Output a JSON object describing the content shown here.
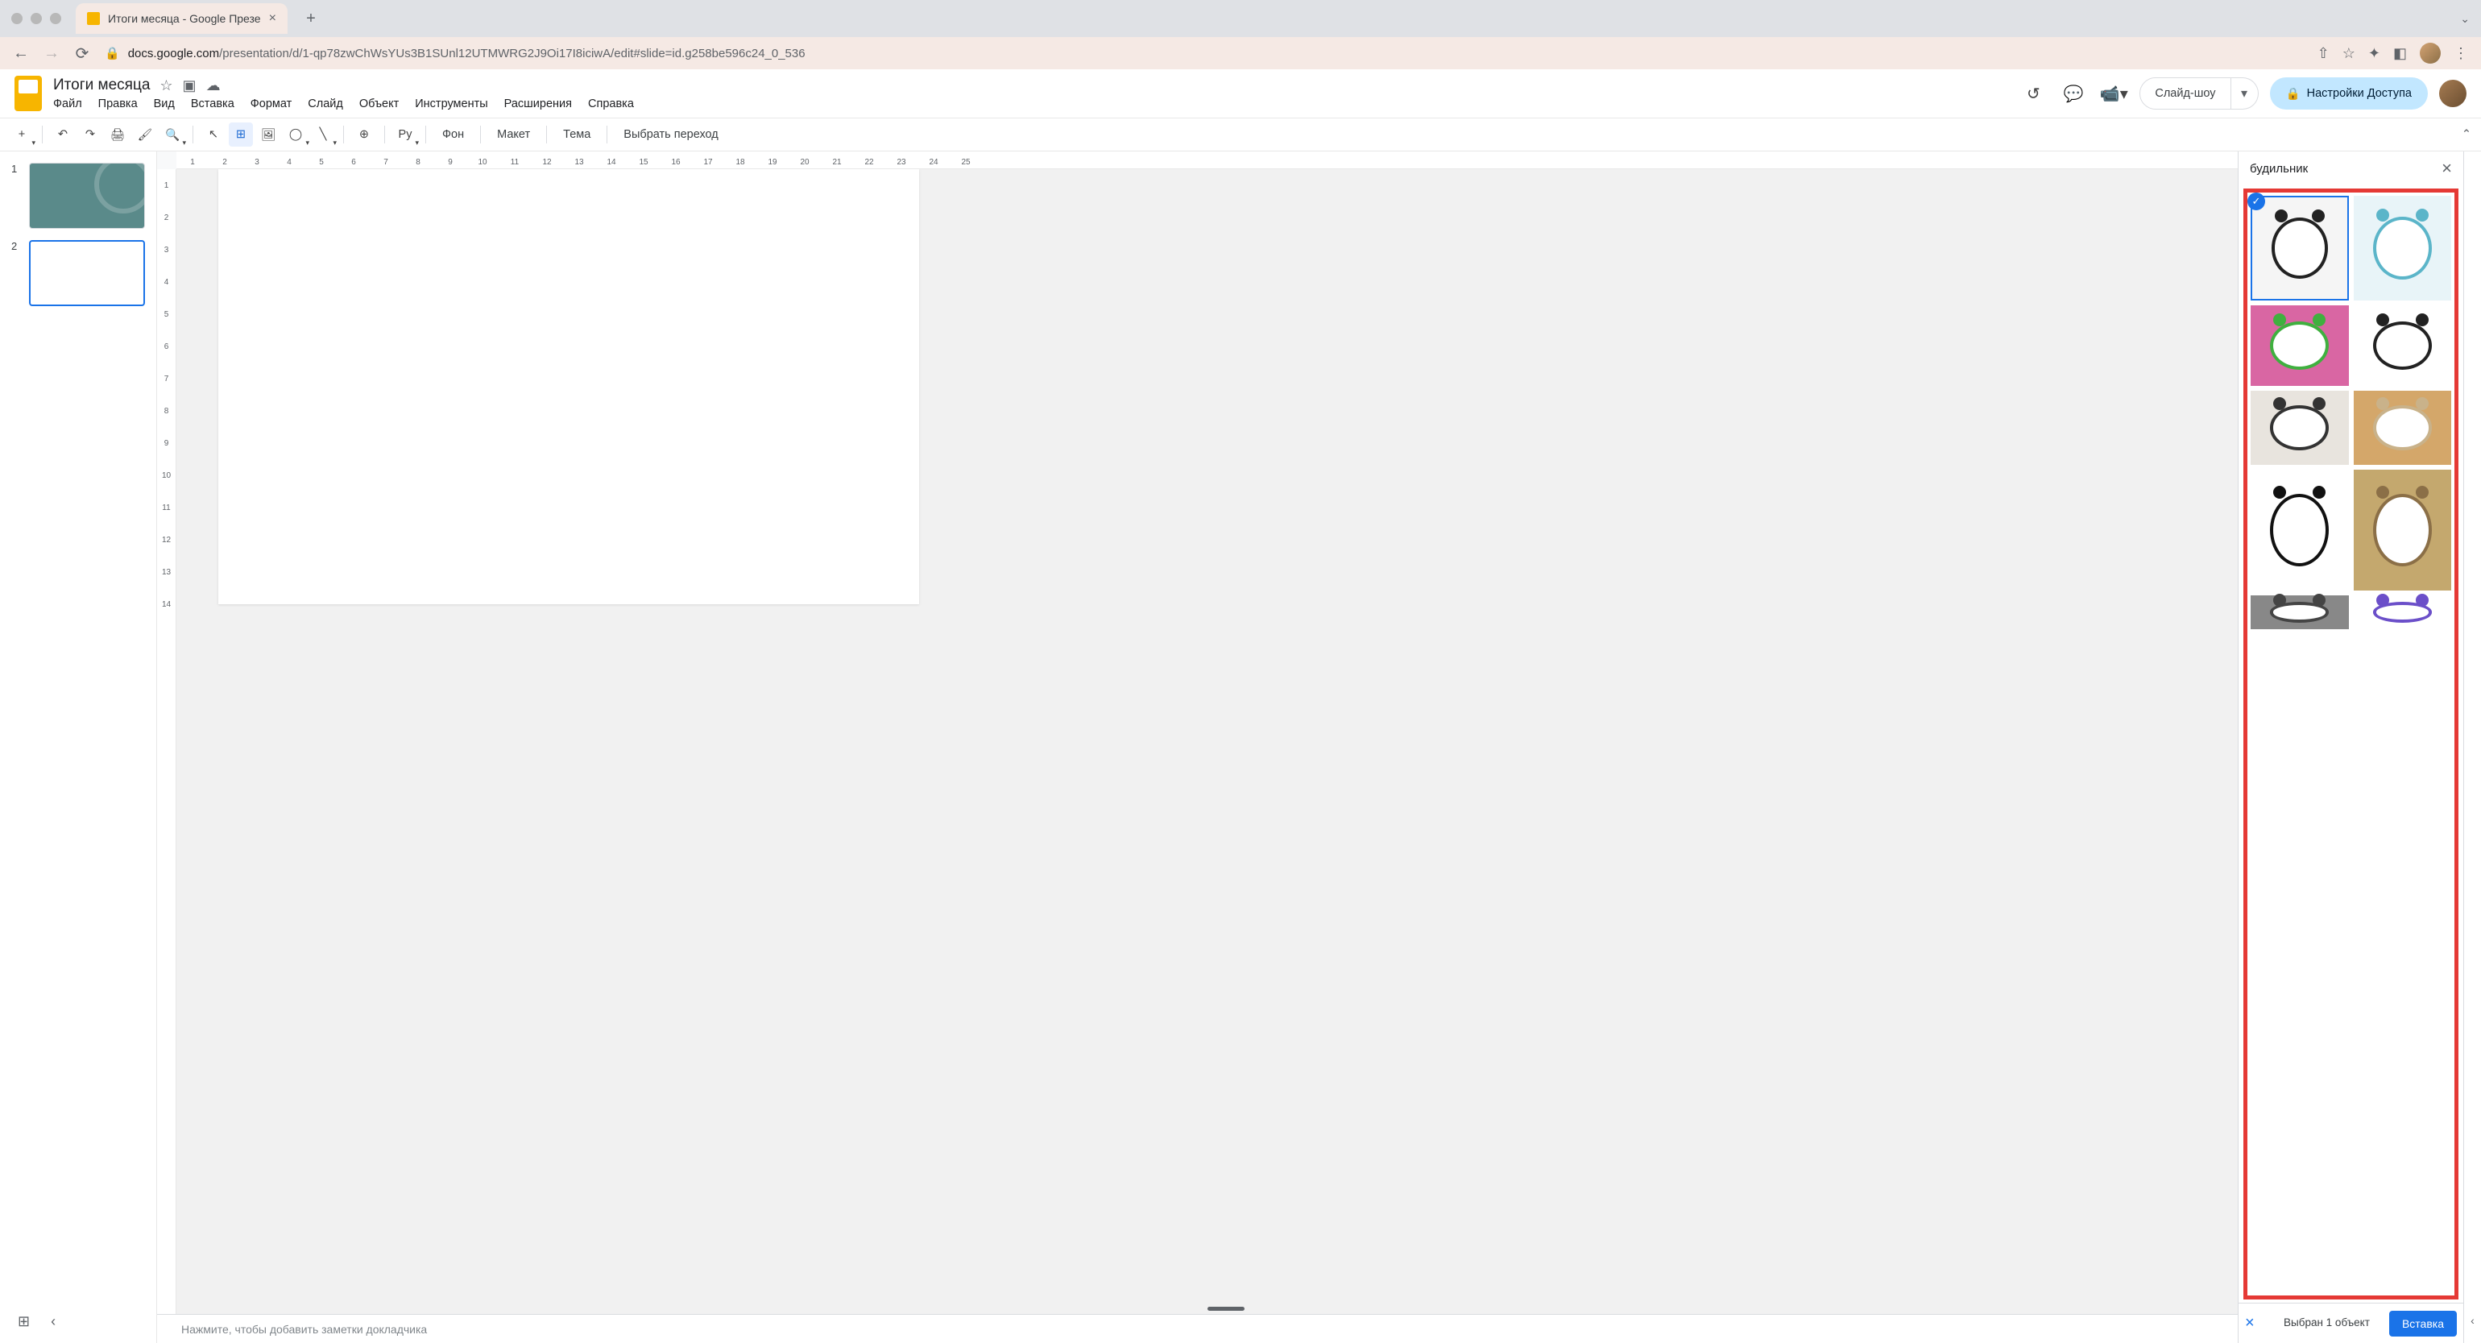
{
  "browser": {
    "tab_title": "Итоги месяца - Google Презе",
    "url_domain": "docs.google.com",
    "url_path": "/presentation/d/1-qp78zwChWsYUs3B1SUnl12UTMWRG2J9Oi17I8iciwA/edit#slide=id.g258be596c24_0_536"
  },
  "doc": {
    "title": "Итоги месяца"
  },
  "menu": {
    "file": "Файл",
    "edit": "Правка",
    "view": "Вид",
    "insert": "Вставка",
    "format": "Формат",
    "slide": "Слайд",
    "object": "Объект",
    "tools": "Инструменты",
    "extensions": "Расширения",
    "help": "Справка"
  },
  "header": {
    "slideshow": "Слайд-шоу",
    "share": "Настройки Доступа"
  },
  "toolbar": {
    "background": "Фон",
    "layout": "Макет",
    "theme": "Тема",
    "transition": "Выбрать переход"
  },
  "slides": {
    "s1": "1",
    "s2": "2"
  },
  "notes": {
    "placeholder": "Нажмите, чтобы добавить заметки докладчика"
  },
  "search": {
    "term": "будильник",
    "selected_text": "Выбран 1 объект",
    "insert": "Вставка"
  },
  "images": [
    {
      "bg": "#f5f5f5",
      "fg": "#222",
      "selected": true,
      "h": 130
    },
    {
      "bg": "#e8f4f8",
      "fg": "#5bb5c9",
      "selected": false,
      "h": 130
    },
    {
      "bg": "#d966a3",
      "fg": "#3fb03f",
      "selected": false,
      "h": 100
    },
    {
      "bg": "#ffffff",
      "fg": "#222",
      "selected": false,
      "h": 100
    },
    {
      "bg": "#e8e4de",
      "fg": "#333",
      "selected": false,
      "h": 92
    },
    {
      "bg": "#d4a76a",
      "fg": "#c9b28a",
      "selected": false,
      "h": 92
    },
    {
      "bg": "#ffffff",
      "fg": "#111",
      "selected": false,
      "h": 150
    },
    {
      "bg": "#c4a86e",
      "fg": "#8b6f47",
      "selected": false,
      "h": 150
    },
    {
      "bg": "#888",
      "fg": "#444",
      "selected": false,
      "h": 42
    },
    {
      "bg": "#fff",
      "fg": "#6b4fc9",
      "selected": false,
      "h": 42
    }
  ]
}
